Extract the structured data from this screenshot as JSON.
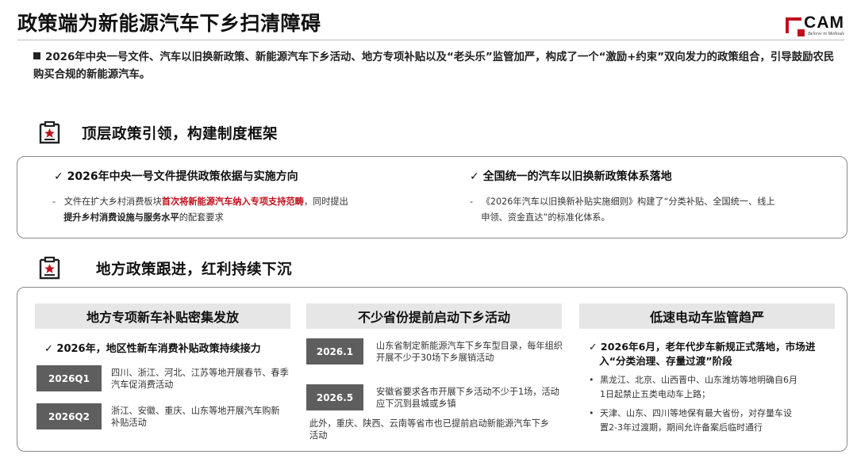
{
  "title": "政策端为新能源汽车下乡扫清障碍",
  "logo": {
    "name": "CAM",
    "tagline": "Believe in Methods",
    "brand_color": "#c0101c"
  },
  "summary": "2026年中央一号文件、汽车以旧换新政策、新能源汽车下乡活动、地方专项补贴以及“老头乐”监管加严，构成了一个“激励+约束”双向发力的政策组合，引导鼓励农民购买合规的新能源汽车。",
  "section1": {
    "icon": "document-star-icon",
    "title": "顶层政策引领，构建制度框架",
    "left": {
      "head": "✓ 2026年中央一号文件提供政策依据与实施方向",
      "bullet_prefix": "-",
      "text_a": "文件在扩大乡村消费板块",
      "text_red": "首次将新能源汽车纳入专项支持范畴",
      "text_b": "，同时提出",
      "text_bold": "提升乡村消费设施与服务水平",
      "text_c": "的配套要求"
    },
    "right": {
      "head": "✓ 全国统一的汽车以旧换新政策体系落地",
      "bullet_prefix": "-",
      "text_line1": "《2026年汽车以旧换新补贴实施细则》构建了“分类补贴、全国统一、线上",
      "text_line2": "申领、资金直达”的标准化体系。"
    }
  },
  "section2": {
    "icon": "document-star-icon",
    "title": "地方政策跟进，红利持续下沉",
    "col1": {
      "header": "地方专项新车补贴密集发放",
      "head": "✓ 2026年，地区性新车消费补贴政策持续接力",
      "items": [
        {
          "tag": "2026Q1",
          "text": "四川、浙江、河北、江苏等地开展春节、春季汽车促消费活动"
        },
        {
          "tag": "2026Q2",
          "text": "浙江、安徽、重庆、山东等地开展汽车购新补贴活动"
        }
      ]
    },
    "col2": {
      "header": "不少省份提前启动下乡活动",
      "items": [
        {
          "tag": "2026.1",
          "text": "山东省制定新能源汽车下乡车型目录，每年组织开展不少于30场下乡展销活动"
        },
        {
          "tag": "2026.5",
          "text": "安徽省要求各市开展下乡活动不少于1场，活动应下沉到县城或乡镇"
        }
      ],
      "footer": "此外，重庆、陕西、云南等省市也已提前启动新能源汽车下乡活动"
    },
    "col3": {
      "header": "低速电动车监管趋严",
      "head_line1": "✓ 2026年6月，老年代步车新规正式落地，市场进",
      "head_line2": "入“分类治理、存量过渡”阶段",
      "bullets": [
        {
          "dot": "•",
          "line1": "黑龙江、北京、山西晋中、山东潍坊等地明确自6月",
          "line2": "1日起禁止五类电动车上路；"
        },
        {
          "dot": "•",
          "line1": "天津、山东、四川等地保有最大省份，对存量车设",
          "line2": "置2-3年过渡期，期间允许备案后临时通行"
        }
      ]
    }
  }
}
